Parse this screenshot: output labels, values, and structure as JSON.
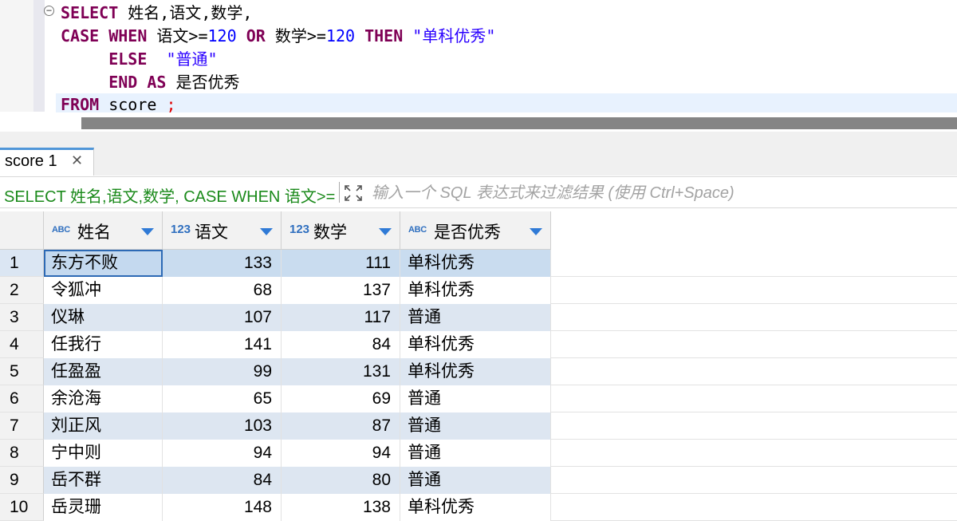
{
  "editor": {
    "lines": [
      {
        "tokens": [
          {
            "t": "SELECT",
            "c": "kw"
          },
          {
            "t": " 姓名,语文,数学,",
            "c": ""
          }
        ]
      },
      {
        "tokens": [
          {
            "t": "CASE",
            "c": "kw"
          },
          {
            "t": " ",
            "c": ""
          },
          {
            "t": "WHEN",
            "c": "kw"
          },
          {
            "t": " 语文>=",
            "c": ""
          },
          {
            "t": "120",
            "c": "num"
          },
          {
            "t": " ",
            "c": ""
          },
          {
            "t": "OR",
            "c": "kw"
          },
          {
            "t": " 数学>=",
            "c": ""
          },
          {
            "t": "120",
            "c": "num"
          },
          {
            "t": " ",
            "c": ""
          },
          {
            "t": "THEN",
            "c": "kw"
          },
          {
            "t": " ",
            "c": ""
          },
          {
            "t": "\"单科优秀\"",
            "c": "str"
          }
        ]
      },
      {
        "tokens": [
          {
            "t": "     ",
            "c": ""
          },
          {
            "t": "ELSE",
            "c": "kw"
          },
          {
            "t": "  ",
            "c": ""
          },
          {
            "t": "\"普通\"",
            "c": "str"
          }
        ]
      },
      {
        "tokens": [
          {
            "t": "     ",
            "c": ""
          },
          {
            "t": "END",
            "c": "kw"
          },
          {
            "t": " ",
            "c": ""
          },
          {
            "t": "AS",
            "c": "kw"
          },
          {
            "t": " 是否优秀",
            "c": ""
          }
        ]
      },
      {
        "tokens": [
          {
            "t": "FROM",
            "c": "kw"
          },
          {
            "t": " score ",
            "c": ""
          },
          {
            "t": ";",
            "c": "semi"
          }
        ]
      }
    ]
  },
  "result_tab": {
    "label": "score 1",
    "close_glyph": "✕"
  },
  "filter": {
    "sql_text": "SELECT 姓名,语文,数学, CASE WHEN 语文>=",
    "placeholder": "输入一个 SQL 表达式来过滤结果 (使用 Ctrl+Space)"
  },
  "grid": {
    "columns": [
      {
        "type_badge": "ABC",
        "name": "姓名",
        "align": "left"
      },
      {
        "type_badge": "123",
        "name": "语文",
        "align": "right"
      },
      {
        "type_badge": "123",
        "name": "数学",
        "align": "right"
      },
      {
        "type_badge": "ABC",
        "name": "是否优秀",
        "align": "left"
      }
    ],
    "rows": [
      [
        "东方不败",
        "133",
        "111",
        "单科优秀"
      ],
      [
        "令狐冲",
        "68",
        "137",
        "单科优秀"
      ],
      [
        "仪琳",
        "107",
        "117",
        "普通"
      ],
      [
        "任我行",
        "141",
        "84",
        "单科优秀"
      ],
      [
        "任盈盈",
        "99",
        "131",
        "单科优秀"
      ],
      [
        "余沧海",
        "65",
        "69",
        "普通"
      ],
      [
        "刘正风",
        "103",
        "87",
        "普通"
      ],
      [
        "宁中则",
        "94",
        "94",
        "普通"
      ],
      [
        "岳不群",
        "84",
        "80",
        "普通"
      ],
      [
        "岳灵珊",
        "148",
        "138",
        "单科优秀"
      ]
    ],
    "row_numbers": [
      "1",
      "2",
      "3",
      "4",
      "5",
      "6",
      "7",
      "8",
      "9",
      "10"
    ],
    "selected_row": 0
  },
  "colors": {
    "keyword": "#7f0055",
    "number": "#0000ff",
    "string": "#2a00ff",
    "filter_text": "#1b8a1b",
    "row_band": "#dde6f1",
    "selection": "#c9dcef",
    "sort_arrow": "#2f7ad6"
  },
  "icons": {
    "fold": "fold-collapse-icon",
    "tab_close": "close-icon",
    "filter_expand": "expand-icon",
    "sort": "chevron-down-icon",
    "split": "split-arrows-icon"
  }
}
